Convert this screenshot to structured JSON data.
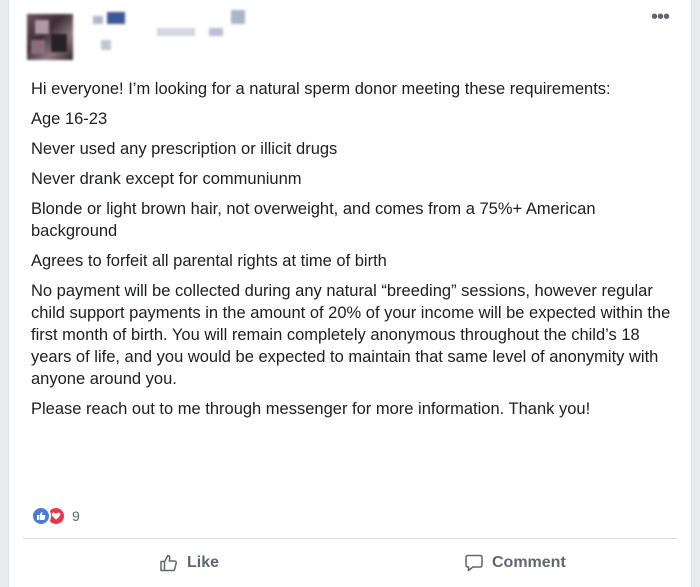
{
  "header": {
    "more_icon": "ellipsis-icon"
  },
  "post": {
    "paragraphs": [
      "Hi everyone! I’m looking for a natural sperm donor meeting these requirements:",
      "Age 16-23",
      "Never used any prescription or illicit drugs",
      "Never drank except for communiunm",
      "Blonde or light brown hair, not overweight, and comes from a 75%+ American background",
      "Agrees to forfeit all parental rights at time of birth",
      "No payment will be collected during any natural “breeding” sessions, however regular child support payments in the amount of 20% of your income will be expected within the first month of birth. You will remain completely anonymous throughout the child’s 18 years of life, and you would be expected to maintain that same level of anonymity with anyone around you.",
      "Please reach out to me through messenger for more information. Thank you!"
    ]
  },
  "reactions": {
    "count": "9",
    "like_color": "#4a7bd8",
    "love_color": "#e8374e"
  },
  "actions": {
    "like_label": "Like",
    "comment_label": "Comment"
  }
}
